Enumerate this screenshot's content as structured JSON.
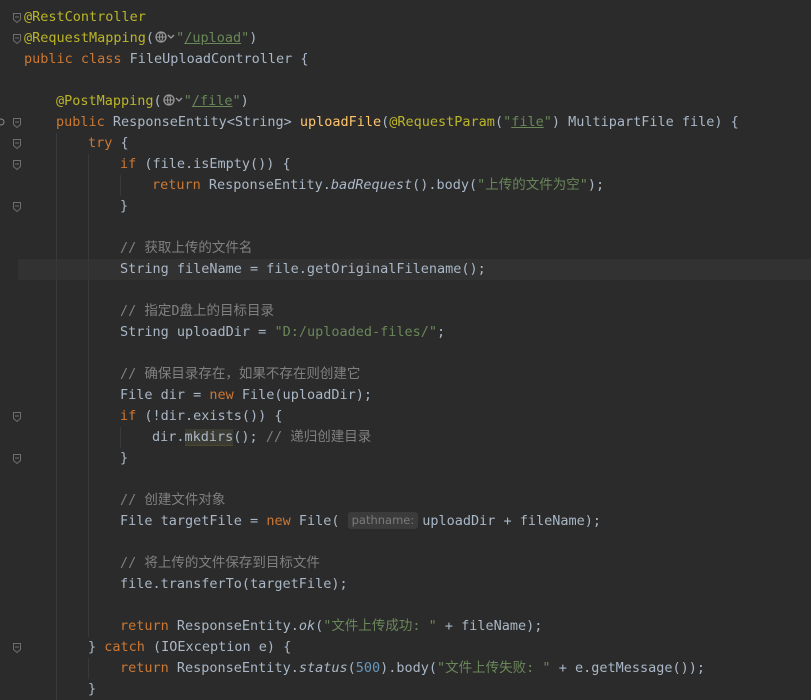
{
  "editor": {
    "lines": [
      {
        "indent": 0,
        "tokens": [
          {
            "c": "ann",
            "t": "@RestController"
          }
        ]
      },
      {
        "indent": 0,
        "tokens": [
          {
            "c": "ann",
            "t": "@RequestMapping"
          },
          {
            "c": "",
            "t": "("
          },
          {
            "c": "globe",
            "t": ""
          },
          {
            "c": "str",
            "t": "\""
          },
          {
            "c": "link-str",
            "t": "/upload"
          },
          {
            "c": "str",
            "t": "\""
          },
          {
            "c": "",
            "t": ")"
          }
        ]
      },
      {
        "indent": 0,
        "tokens": [
          {
            "c": "kw",
            "t": "public class "
          },
          {
            "c": "",
            "t": "FileUploadController {"
          }
        ]
      },
      {
        "indent": 0,
        "tokens": []
      },
      {
        "indent": 1,
        "tokens": [
          {
            "c": "ann",
            "t": "@PostMapping"
          },
          {
            "c": "",
            "t": "("
          },
          {
            "c": "globe",
            "t": ""
          },
          {
            "c": "str",
            "t": "\""
          },
          {
            "c": "link-str",
            "t": "/file"
          },
          {
            "c": "str",
            "t": "\""
          },
          {
            "c": "",
            "t": ")"
          }
        ]
      },
      {
        "indent": 1,
        "tokens": [
          {
            "c": "kw",
            "t": "public "
          },
          {
            "c": "",
            "t": "ResponseEntity<String> "
          },
          {
            "c": "method",
            "t": "uploadFile"
          },
          {
            "c": "",
            "t": "("
          },
          {
            "c": "ann",
            "t": "@RequestParam"
          },
          {
            "c": "",
            "t": "("
          },
          {
            "c": "str",
            "t": "\""
          },
          {
            "c": "link-str",
            "t": "file"
          },
          {
            "c": "str",
            "t": "\""
          },
          {
            "c": "",
            "t": ") MultipartFile file) {"
          }
        ]
      },
      {
        "indent": 2,
        "tokens": [
          {
            "c": "kw",
            "t": "try "
          },
          {
            "c": "",
            "t": "{"
          }
        ]
      },
      {
        "indent": 3,
        "tokens": [
          {
            "c": "kw",
            "t": "if "
          },
          {
            "c": "",
            "t": "(file.isEmpty()) {"
          }
        ]
      },
      {
        "indent": 4,
        "tokens": [
          {
            "c": "kw",
            "t": "return "
          },
          {
            "c": "",
            "t": "ResponseEntity."
          },
          {
            "c": "static-call",
            "t": "badRequest"
          },
          {
            "c": "",
            "t": "().body("
          },
          {
            "c": "str",
            "t": "\"上传的文件为空\""
          },
          {
            "c": "",
            "t": ");"
          }
        ]
      },
      {
        "indent": 3,
        "tokens": [
          {
            "c": "",
            "t": "}"
          }
        ]
      },
      {
        "indent": 3,
        "tokens": []
      },
      {
        "indent": 3,
        "tokens": [
          {
            "c": "cmt",
            "t": "// 获取上传的文件名"
          }
        ]
      },
      {
        "indent": 3,
        "caret": true,
        "tokens": [
          {
            "c": "",
            "t": "String fileName = file.getOriginalFilename();"
          }
        ]
      },
      {
        "indent": 3,
        "tokens": []
      },
      {
        "indent": 3,
        "tokens": [
          {
            "c": "cmt",
            "t": "// 指定D盘上的目标目录"
          }
        ]
      },
      {
        "indent": 3,
        "tokens": [
          {
            "c": "",
            "t": "String uploadDir = "
          },
          {
            "c": "str",
            "t": "\"D:/uploaded-files/\""
          },
          {
            "c": "",
            "t": ";"
          }
        ]
      },
      {
        "indent": 3,
        "tokens": []
      },
      {
        "indent": 3,
        "tokens": [
          {
            "c": "cmt",
            "t": "// 确保目录存在，如果不存在则创建它"
          }
        ]
      },
      {
        "indent": 3,
        "tokens": [
          {
            "c": "",
            "t": "File dir = "
          },
          {
            "c": "kw",
            "t": "new "
          },
          {
            "c": "",
            "t": "File(uploadDir);"
          }
        ]
      },
      {
        "indent": 3,
        "tokens": [
          {
            "c": "kw",
            "t": "if "
          },
          {
            "c": "",
            "t": "(!dir.exists()) {"
          }
        ]
      },
      {
        "indent": 4,
        "tokens": [
          {
            "c": "",
            "t": "dir."
          },
          {
            "c": "hl-usage",
            "t": "mkdirs"
          },
          {
            "c": "",
            "t": "(); "
          },
          {
            "c": "cmt",
            "t": "// 递归创建目录"
          }
        ]
      },
      {
        "indent": 3,
        "tokens": [
          {
            "c": "",
            "t": "}"
          }
        ]
      },
      {
        "indent": 3,
        "tokens": []
      },
      {
        "indent": 3,
        "tokens": [
          {
            "c": "cmt",
            "t": "// 创建文件对象"
          }
        ]
      },
      {
        "indent": 3,
        "tokens": [
          {
            "c": "",
            "t": "File targetFile = "
          },
          {
            "c": "kw",
            "t": "new "
          },
          {
            "c": "",
            "t": "File( "
          },
          {
            "c": "hint",
            "t": "pathname:"
          },
          {
            "c": "",
            "t": "uploadDir + fileName);"
          }
        ]
      },
      {
        "indent": 3,
        "tokens": []
      },
      {
        "indent": 3,
        "tokens": [
          {
            "c": "cmt",
            "t": "// 将上传的文件保存到目标文件"
          }
        ]
      },
      {
        "indent": 3,
        "tokens": [
          {
            "c": "",
            "t": "file.transferTo(targetFile);"
          }
        ]
      },
      {
        "indent": 3,
        "tokens": []
      },
      {
        "indent": 3,
        "tokens": [
          {
            "c": "kw",
            "t": "return "
          },
          {
            "c": "",
            "t": "ResponseEntity."
          },
          {
            "c": "static-call",
            "t": "ok"
          },
          {
            "c": "",
            "t": "("
          },
          {
            "c": "str",
            "t": "\"文件上传成功: \""
          },
          {
            "c": "",
            "t": " + fileName);"
          }
        ]
      },
      {
        "indent": 2,
        "tokens": [
          {
            "c": "",
            "t": "} "
          },
          {
            "c": "kw",
            "t": "catch "
          },
          {
            "c": "",
            "t": "(IOException e) {"
          }
        ]
      },
      {
        "indent": 3,
        "tokens": [
          {
            "c": "kw",
            "t": "return "
          },
          {
            "c": "",
            "t": "ResponseEntity."
          },
          {
            "c": "static-call",
            "t": "status"
          },
          {
            "c": "",
            "t": "("
          },
          {
            "c": "num",
            "t": "500"
          },
          {
            "c": "",
            "t": ").body("
          },
          {
            "c": "str",
            "t": "\"文件上传失败: \""
          },
          {
            "c": "",
            "t": " + e.getMessage());"
          }
        ]
      },
      {
        "indent": 2,
        "tokens": [
          {
            "c": "",
            "t": "}"
          }
        ]
      }
    ]
  },
  "colors": {
    "background": "#2b2b2b",
    "keyword": "#cc7832",
    "annotation": "#bbb529",
    "string": "#6a8759",
    "comment": "#808080",
    "method": "#ffc66d",
    "number": "#6897bb",
    "text": "#a9b7c6"
  },
  "icons": {
    "gutter_fold": "fold-marker-icon",
    "gutter_breakpoint": "method-marker-icon",
    "url_globe": "globe-icon"
  }
}
